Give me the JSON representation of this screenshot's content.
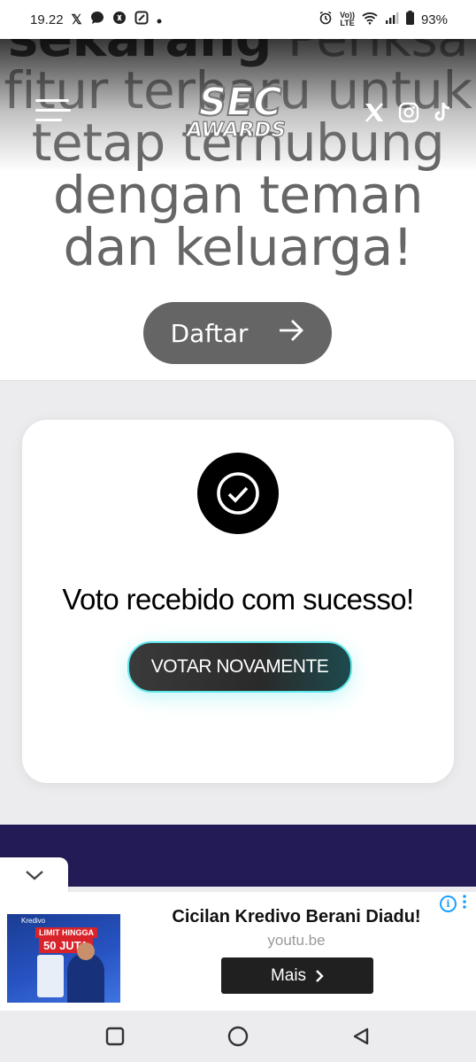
{
  "status_bar": {
    "time": "19.22",
    "icons_left": [
      "x-icon",
      "chat-icon",
      "shazam-icon",
      "gallery-icon",
      "dot-icon"
    ],
    "icons_right": [
      "alarm-icon",
      "volte-icon",
      "wifi-icon",
      "signal-icon",
      "battery-icon"
    ],
    "volte_top": "Vo))",
    "volte_bottom": "LTE",
    "battery_percent": "93%"
  },
  "hero": {
    "text_bold": "sekarang",
    "text_rest": " Periksa fitur terbaru untuk tetap terhubung dengan teman dan keluarga!",
    "logo_line1": "SEC",
    "logo_line2": "AWARDS",
    "social_icons": [
      "x-icon",
      "instagram-icon",
      "tiktok-icon"
    ],
    "register_label": "Daftar"
  },
  "vote_card": {
    "message": "Voto recebido com sucesso!",
    "vote_again_label": "VOTAR NOVAMENTE"
  },
  "ad": {
    "image_brand": "Kredivo",
    "image_badge_line1": "LIMIT HINGGA",
    "image_badge_line2": "50 JUTA",
    "title": "Cicilan Kredivo Berani Diadu!",
    "url": "youtu.be",
    "cta_label": "Mais"
  },
  "nav_bar": {
    "buttons": [
      "recents-icon",
      "home-icon",
      "back-icon"
    ]
  }
}
